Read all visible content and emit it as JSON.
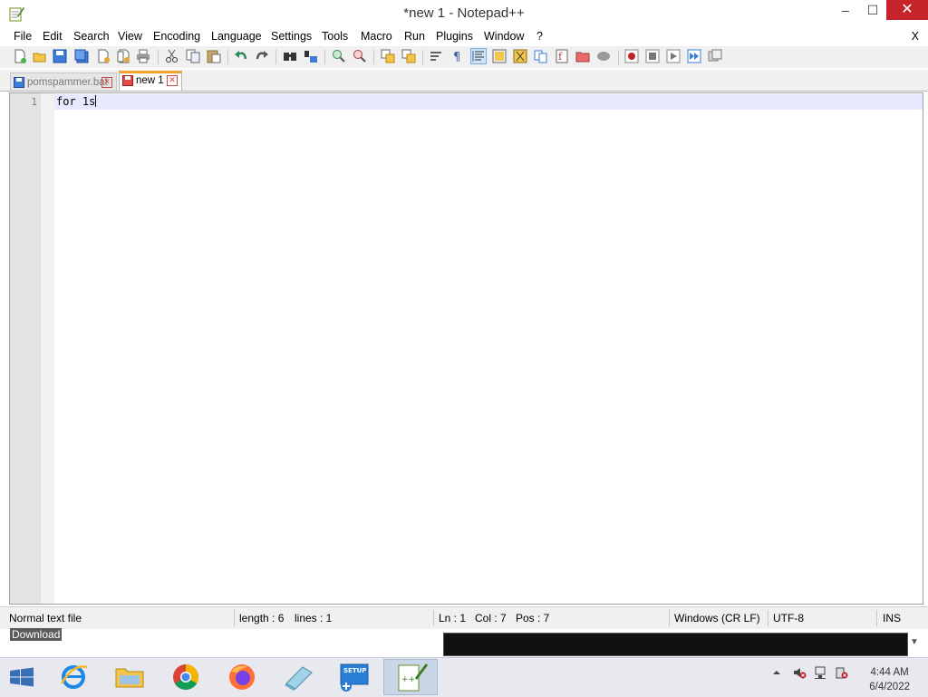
{
  "window": {
    "title": "*new 1 - Notepad++",
    "minimize_glyph": "–",
    "maximize_glyph": "☐",
    "close_glyph": "✕"
  },
  "menu": {
    "items": [
      "File",
      "Edit",
      "Search",
      "View",
      "Encoding",
      "Language",
      "Settings",
      "Tools",
      "Macro",
      "Run",
      "Plugins",
      "Window",
      "?"
    ],
    "close_doc": "X"
  },
  "toolbar": {
    "icons": [
      "new-file-icon",
      "open-file-icon",
      "save-icon",
      "save-all-icon",
      "close-icon",
      "close-all-icon",
      "print-icon",
      "cut-icon",
      "copy-icon",
      "paste-icon",
      "undo-icon",
      "redo-icon",
      "find-icon",
      "replace-icon",
      "zoom-in-icon",
      "zoom-out-icon",
      "sync-vertical-icon",
      "sync-horizontal-icon",
      "word-wrap-icon",
      "show-all-chars-icon",
      "indent-guide-icon",
      "user-language-icon",
      "doc-map-icon",
      "document-list-icon",
      "function-list-icon",
      "folder-workspace-icon",
      "monitoring-icon",
      "record-macro-icon",
      "stop-record-icon",
      "play-macro-icon",
      "run-multiple-icon",
      "save-macro-icon"
    ]
  },
  "tabs": [
    {
      "label": "pomspammer.bat",
      "active": false
    },
    {
      "label": "new 1",
      "active": true
    }
  ],
  "editor": {
    "line_numbers": [
      "1"
    ],
    "lines": [
      "for 1s"
    ]
  },
  "status": {
    "file_type": "Normal text file",
    "length": "length : 6",
    "lines": "lines : 1",
    "ln": "Ln : 1",
    "col": "Col : 7",
    "pos": "Pos : 7",
    "eol": "Windows (CR LF)",
    "encoding": "UTF-8",
    "mode": "INS"
  },
  "desktop": {
    "download_label": "Download"
  },
  "taskbar": {
    "apps": [
      "start-icon",
      "internet-explorer-icon",
      "file-explorer-icon",
      "chrome-icon",
      "firefox-icon",
      "notepad-icon",
      "setup-icon",
      "notepadpp-icon"
    ],
    "setup_label": "SETUP",
    "time": "4:44 AM",
    "date": "6/4/2022"
  },
  "colors": {
    "active_tab_accent": "#f6a12c",
    "close_button": "#c7232a",
    "current_line": "#e8e8ff"
  }
}
